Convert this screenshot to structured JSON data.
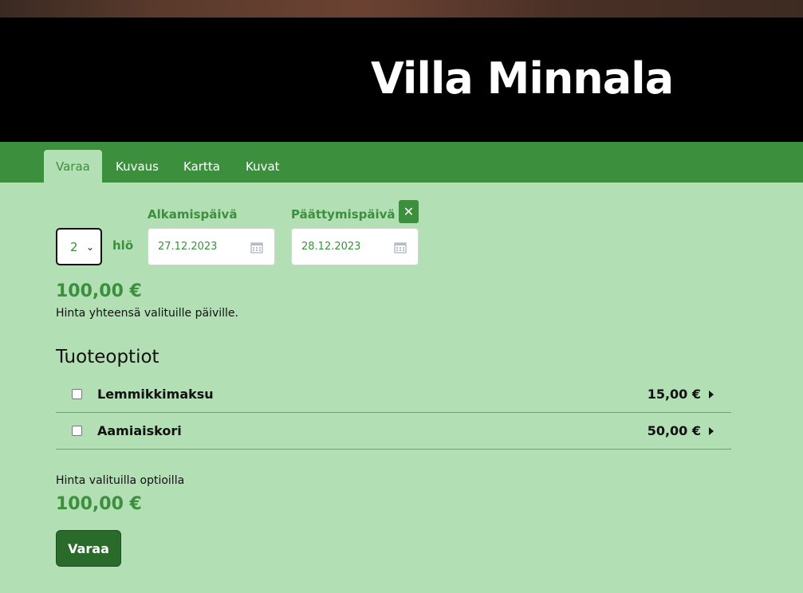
{
  "site": {
    "title": "Villa Minnala"
  },
  "nav": {
    "tabs": [
      {
        "label": "Varaa",
        "active": true
      },
      {
        "label": "Kuvaus",
        "active": false
      },
      {
        "label": "Kartta",
        "active": false
      },
      {
        "label": "Kuvat",
        "active": false
      }
    ]
  },
  "booking": {
    "persons_value": "2",
    "persons_unit": "hlö",
    "start_label": "Alkamispäivä",
    "start_value": "27.12.2023",
    "end_label": "Päättymispäivä",
    "end_value": "28.12.2023",
    "clear_icon": "close-icon",
    "price": "100,00 €",
    "price_note": "Hinta yhteensä valituille päiville."
  },
  "options": {
    "title": "Tuoteoptiot",
    "items": [
      {
        "name": "Lemmikkimaksu",
        "price": "15,00 €",
        "checked": false
      },
      {
        "name": "Aamiaiskori",
        "price": "50,00 €",
        "checked": false
      }
    ]
  },
  "summary": {
    "label": "Hinta valituilla optioilla",
    "price": "100,00 €",
    "book_label": "Varaa"
  },
  "colors": {
    "page_bg": "#b3dfb4",
    "header_bg": "#000000",
    "nav_bg": "#3b8f3d",
    "accent": "#3b8f3d",
    "button_bg": "#2a6b2c"
  }
}
